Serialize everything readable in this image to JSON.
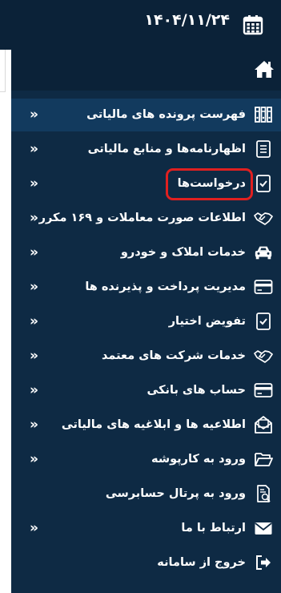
{
  "header": {
    "date": "۱۴۰۴/۱۱/۲۴",
    "calendar_icon": "calendar-icon",
    "home_icon": "home-icon"
  },
  "menu": {
    "items": [
      {
        "label": "فهرست پرونده های مالیاتی",
        "icon": "binders-icon",
        "has_submenu": true,
        "active": true
      },
      {
        "label": "اظهارنامه‌ها و منابع مالیاتی",
        "icon": "document-list-icon",
        "has_submenu": true
      },
      {
        "label": "درخواست‌ها",
        "icon": "document-check-icon",
        "has_submenu": true,
        "highlighted": true
      },
      {
        "label": "اطلاعات صورت معاملات و ۱۶۹ مکرر",
        "icon": "handshake-icon",
        "has_submenu": true
      },
      {
        "label": "خدمات املاک و خودرو",
        "icon": "car-icon",
        "has_submenu": true
      },
      {
        "label": "مدیریت پرداخت و پذیرنده ها",
        "icon": "credit-card-icon",
        "has_submenu": true
      },
      {
        "label": "تفویض اختیار",
        "icon": "document-check-icon",
        "has_submenu": true
      },
      {
        "label": "خدمات شرکت های معتمد",
        "icon": "handshake-icon",
        "has_submenu": true
      },
      {
        "label": "حساب های بانکی",
        "icon": "credit-card-icon",
        "has_submenu": true
      },
      {
        "label": "اطلاعیه ها و ابلاغیه های مالیاتی",
        "icon": "envelope-open-icon",
        "has_submenu": true
      },
      {
        "label": "ورود به کارپوشه",
        "icon": "folder-open-icon",
        "has_submenu": true
      },
      {
        "label": "ورود به پرتال حسابرسی",
        "icon": "audit-document-icon",
        "has_submenu": false
      },
      {
        "label": "ارتباط با ما",
        "icon": "envelope-icon",
        "has_submenu": true
      },
      {
        "label": "خروج از سامانه",
        "icon": "sign-out-icon",
        "has_submenu": false
      }
    ],
    "chevron": "«"
  },
  "colors": {
    "background": "#0b2238",
    "menu_bg": "#0e2a44",
    "active_bg": "#123a5e",
    "highlight": "#e02020"
  }
}
